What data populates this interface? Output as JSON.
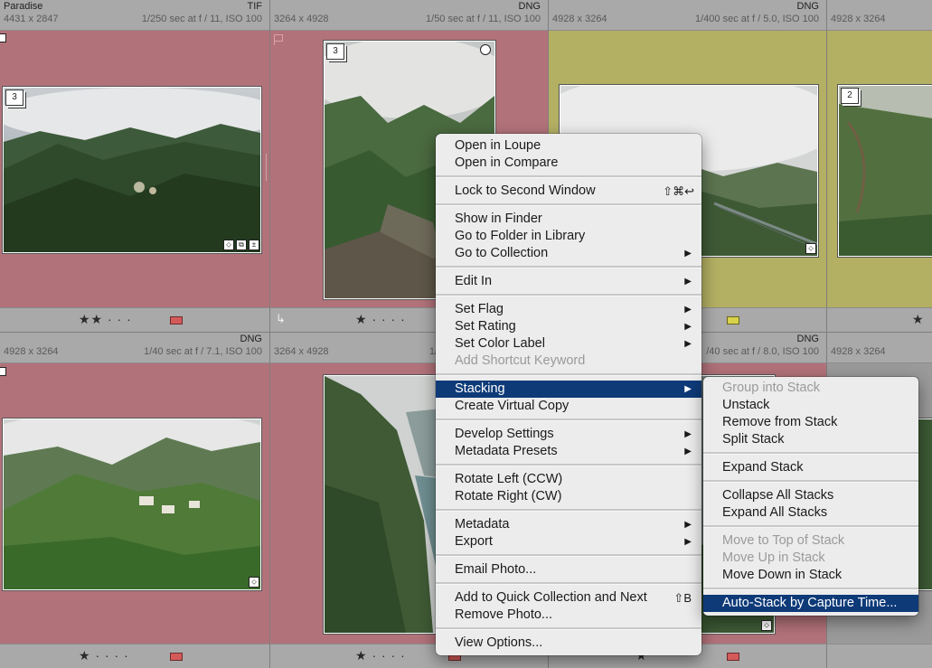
{
  "cells": [
    {
      "title": "Paradise",
      "format": "TIF",
      "dims": "4431 x 2847",
      "exposure": "1/250 sec at f / 11, ISO 100",
      "stack": "3",
      "rating": "★★ · · ·",
      "label_color": "#d45a5a",
      "bg": "#b2727a"
    },
    {
      "title": "",
      "format": "DNG",
      "dims": "3264 x 4928",
      "exposure": "1/50 sec at f / 11, ISO 100",
      "stack": "3",
      "rating": "★ · · · ·",
      "label_color": "#d45a5a",
      "bg": "#b2727a"
    },
    {
      "title": "",
      "format": "DNG",
      "dims": "4928 x 3264",
      "exposure": "1/400 sec at f / 5.0, ISO 100",
      "stack": "",
      "rating": "",
      "label_color": "#d8d24a",
      "bg": "#b3af63"
    },
    {
      "title": "",
      "format": "",
      "dims": "4928 x 3264",
      "exposure": "",
      "stack": "2",
      "rating": "★",
      "label_color": "",
      "bg": "#b3af63"
    },
    {
      "title": "",
      "format": "DNG",
      "dims": "4928 x 3264",
      "exposure": "1/40 sec at f / 7.1, ISO 100",
      "stack": "",
      "rating": "★ · · · ·",
      "label_color": "#d45a5a",
      "bg": "#b2727a"
    },
    {
      "title": "",
      "format": "",
      "dims": "3264 x 4928",
      "exposure": "1/",
      "stack": "",
      "rating": "★ · · · ·",
      "label_color": "#d45a5a",
      "bg": "#b2727a"
    },
    {
      "title": "",
      "format": "DNG",
      "dims": "",
      "exposure": "/40 sec at f / 8.0, ISO 100",
      "stack": "",
      "rating": "★",
      "label_color": "#d45a5a",
      "bg": "#b2727a"
    },
    {
      "title": "",
      "format": "",
      "dims": "4928 x 3264",
      "exposure": "",
      "stack": "",
      "rating": "",
      "label_color": "",
      "bg": "#9a9a9a"
    }
  ],
  "menu": {
    "open_loupe": "Open in Loupe",
    "open_compare": "Open in Compare",
    "lock_second": "Lock to Second Window",
    "lock_second_sc": "⇧⌘↩",
    "show_finder": "Show in Finder",
    "goto_folder": "Go to Folder in Library",
    "goto_collection": "Go to Collection",
    "edit_in": "Edit In",
    "set_flag": "Set Flag",
    "set_rating": "Set Rating",
    "set_color": "Set Color Label",
    "add_shortcut": "Add Shortcut Keyword",
    "stacking": "Stacking",
    "virtual_copy": "Create Virtual Copy",
    "develop_settings": "Develop Settings",
    "metadata_presets": "Metadata Presets",
    "rotate_left": "Rotate Left (CCW)",
    "rotate_right": "Rotate Right (CW)",
    "metadata": "Metadata",
    "export": "Export",
    "email": "Email Photo...",
    "quick_collection": "Add to Quick Collection and Next",
    "quick_collection_sc": "⇧B",
    "remove_photo": "Remove Photo...",
    "view_options": "View Options...",
    "arrow": "▶"
  },
  "submenu": {
    "group": "Group into Stack",
    "unstack": "Unstack",
    "remove_from": "Remove from Stack",
    "split": "Split Stack",
    "expand": "Expand Stack",
    "collapse_all": "Collapse All Stacks",
    "expand_all": "Expand All Stacks",
    "move_top": "Move to Top of Stack",
    "move_up": "Move Up in Stack",
    "move_down": "Move Down in Stack",
    "auto_stack": "Auto-Stack by Capture Time..."
  }
}
